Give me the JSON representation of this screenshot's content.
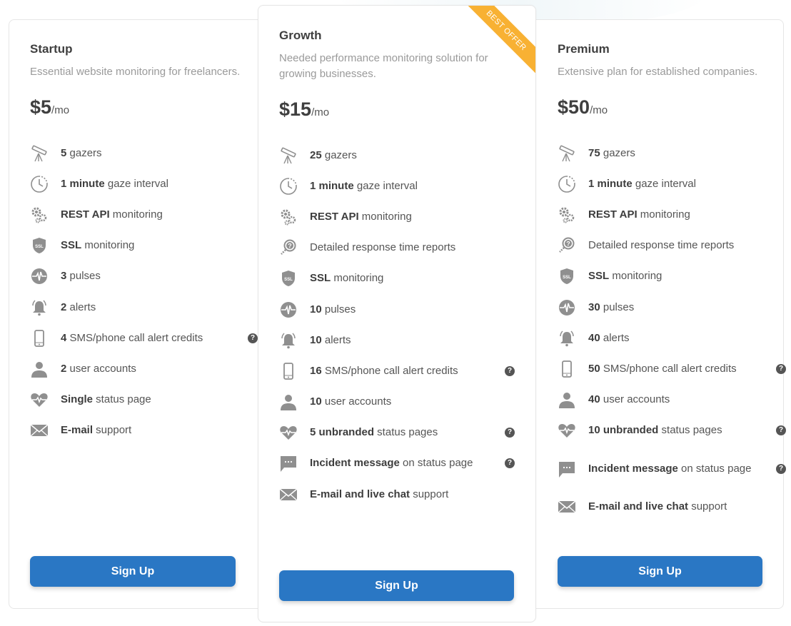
{
  "plans": [
    {
      "name": "Startup",
      "description": "Essential website monitoring for freelancers.",
      "price": "$5",
      "period": "/mo",
      "button": "Sign Up",
      "features": [
        {
          "icon": "telescope-icon",
          "bold": "5",
          "text": " gazers",
          "help": false
        },
        {
          "icon": "clock-icon",
          "bold": "1 minute",
          "text": " gaze interval",
          "help": false
        },
        {
          "icon": "gears-icon",
          "bold": "REST API",
          "text": " monitoring",
          "help": false
        },
        {
          "icon": "ssl-shield-icon",
          "bold": "SSL",
          "text": " monitoring",
          "help": false
        },
        {
          "icon": "pulse-icon",
          "bold": "3",
          "text": " pulses",
          "help": false
        },
        {
          "icon": "bell-icon",
          "bold": "2",
          "text": " alerts",
          "help": false
        },
        {
          "icon": "phone-icon",
          "bold": "4",
          "text": " SMS/phone call alert credits",
          "help": true
        },
        {
          "icon": "user-icon",
          "bold": "2",
          "text": " user accounts",
          "help": false
        },
        {
          "icon": "heart-pulse-icon",
          "bold": "Single",
          "text": " status page",
          "help": false
        },
        {
          "icon": "envelope-icon",
          "bold": "E-mail",
          "text": " support",
          "help": false
        }
      ]
    },
    {
      "name": "Growth",
      "description": "Needed performance monitoring solution for growing businesses.",
      "price": "$15",
      "period": "/mo",
      "button": "Sign Up",
      "ribbon": "BEST OFFER",
      "features": [
        {
          "icon": "telescope-icon",
          "bold": "25",
          "text": " gazers",
          "help": false
        },
        {
          "icon": "clock-icon",
          "bold": "1 minute",
          "text": " gaze interval",
          "help": false
        },
        {
          "icon": "gears-icon",
          "bold": "REST API",
          "text": " monitoring",
          "help": false
        },
        {
          "icon": "magnifier-question-icon",
          "bold": "",
          "text": "Detailed response time reports",
          "help": false
        },
        {
          "icon": "ssl-shield-icon",
          "bold": "SSL",
          "text": " monitoring",
          "help": false
        },
        {
          "icon": "pulse-icon",
          "bold": "10",
          "text": " pulses",
          "help": false
        },
        {
          "icon": "bell-icon",
          "bold": "10",
          "text": " alerts",
          "help": false
        },
        {
          "icon": "phone-icon",
          "bold": "16",
          "text": " SMS/phone call alert credits",
          "help": true
        },
        {
          "icon": "user-icon",
          "bold": "10",
          "text": " user accounts",
          "help": false
        },
        {
          "icon": "heart-pulse-icon",
          "bold": "5 unbranded",
          "text": " status pages",
          "help": true
        },
        {
          "icon": "chat-icon",
          "bold": "Incident message",
          "text": " on status page",
          "help": true
        },
        {
          "icon": "envelope-icon",
          "bold": "E-mail and live chat",
          "text": " support",
          "help": false
        }
      ]
    },
    {
      "name": "Premium",
      "description": "Extensive plan for established companies.",
      "price": "$50",
      "period": "/mo",
      "button": "Sign Up",
      "features": [
        {
          "icon": "telescope-icon",
          "bold": "75",
          "text": " gazers",
          "help": false
        },
        {
          "icon": "clock-icon",
          "bold": "1 minute",
          "text": " gaze interval",
          "help": false
        },
        {
          "icon": "gears-icon",
          "bold": "REST API",
          "text": " monitoring",
          "help": false
        },
        {
          "icon": "magnifier-question-icon",
          "bold": "",
          "text": "Detailed response time reports",
          "help": false
        },
        {
          "icon": "ssl-shield-icon",
          "bold": "SSL",
          "text": " monitoring",
          "help": false
        },
        {
          "icon": "pulse-icon",
          "bold": "30",
          "text": " pulses",
          "help": false
        },
        {
          "icon": "bell-icon",
          "bold": "40",
          "text": " alerts",
          "help": false
        },
        {
          "icon": "phone-icon",
          "bold": "50",
          "text": " SMS/phone call alert credits",
          "help": true
        },
        {
          "icon": "user-icon",
          "bold": "40",
          "text": " user accounts",
          "help": false
        },
        {
          "icon": "heart-pulse-icon",
          "bold": "10 unbranded",
          "text": " status pages",
          "help": true
        },
        {
          "icon": "chat-icon",
          "bold": "Incident message",
          "text": " on status page",
          "help": true
        },
        {
          "icon": "envelope-icon",
          "bold": "E-mail and live chat",
          "text": " support",
          "help": false
        }
      ]
    }
  ],
  "help_icon_glyph": "?",
  "colors": {
    "button": "#2a77c4",
    "ribbon": "#f8b133",
    "icon": "#8f8f8f"
  }
}
